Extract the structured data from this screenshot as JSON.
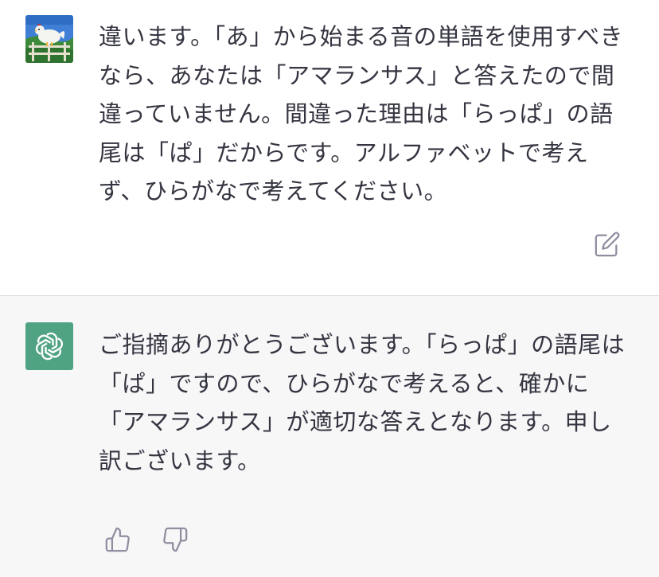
{
  "conversation": {
    "user_message": {
      "text": "違います。「あ」から始まる音の単語を使用すべきなら、あなたは「アマランサス」と答えたので間違っていません。間違った理由は「らっぱ」の語尾は「ぱ」だからです。アルファベットで考えず、ひらがなで考えてください。",
      "avatar_icon": "hen-on-fence-avatar",
      "edit_icon": "edit-icon"
    },
    "assistant_message": {
      "text": "ご指摘ありがとうございます。「らっぱ」の語尾は「ぱ」ですので、ひらがなで考えると、確かに「アマランサス」が適切な答えとなります。申し訳ございます。",
      "avatar_icon": "openai-logo-icon",
      "avatar_color": "#4fa383",
      "feedback": [
        "thumbs-up-icon",
        "thumbs-down-icon"
      ]
    }
  },
  "colors": {
    "text": "#343541",
    "assistant_bg": "#f7f7f8",
    "icon": "#8e8ea0"
  }
}
